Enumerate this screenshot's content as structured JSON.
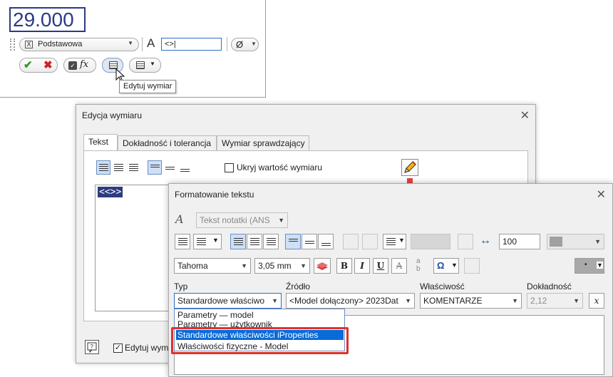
{
  "mini_toolbar": {
    "dimension_value": "29.000",
    "style_name": "Podstawowa",
    "style_box": "X",
    "font_icon": "A",
    "text_field_value": "<>|",
    "diameter_symbol": "Ø",
    "tooltip": "Edytuj wymiar"
  },
  "edit_dialog": {
    "title": "Edycja wymiaru",
    "tabs": [
      "Tekst",
      "Dokładność i tolerancja",
      "Wymiar sprawdzający"
    ],
    "hide_value_label": "Ukryj wartość wymiaru",
    "editor_token": "<<>>",
    "edit_dim_label": "Edytuj wym",
    "edit_dim_checked": "✓"
  },
  "format_dialog": {
    "title": "Formatowanie tekstu",
    "text_style_combo": "Tekst notatki (ANS",
    "stretch_value": "100",
    "font_combo": "Tahoma",
    "size_combo": "3,05 mm",
    "bold": "B",
    "italic": "I",
    "underline": "U",
    "strike": "A",
    "labels": {
      "type": "Typ",
      "source": "Źródło",
      "property": "Właściwość",
      "precision": "Dokładność"
    },
    "type_combo": "Standardowe właściwo",
    "source_combo": "<Model dołączony> 2023Dat",
    "property_combo": "KOMENTARZE",
    "precision_combo": "2,12",
    "type_options": [
      "Parametry — model",
      "Parametry — użytkownik",
      "Standardowe właściwości iProperties",
      "Właściwości fizyczne - Model"
    ],
    "selected_option_index": 2,
    "colors": {
      "highlight_red": "#e0312d",
      "selection_blue": "#0a6ad8",
      "token_blue": "#2d3b80"
    }
  }
}
